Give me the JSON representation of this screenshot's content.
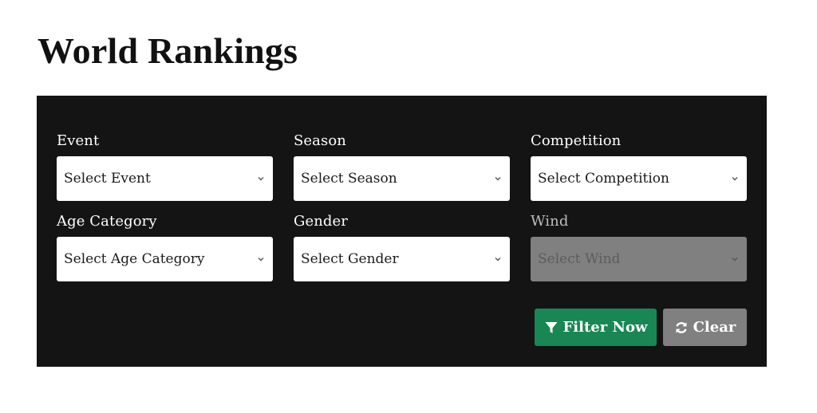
{
  "page": {
    "title": "World Rankings"
  },
  "filters": {
    "event": {
      "label": "Event",
      "value": "Select Event"
    },
    "season": {
      "label": "Season",
      "value": "Select Season"
    },
    "competition": {
      "label": "Competition",
      "value": "Select Competition"
    },
    "age_category": {
      "label": "Age Category",
      "value": "Select Age Category"
    },
    "gender": {
      "label": "Gender",
      "value": "Select Gender"
    },
    "wind": {
      "label": "Wind",
      "value": "Select Wind",
      "disabled": true
    }
  },
  "actions": {
    "filter_label": "Filter Now",
    "clear_label": "Clear"
  },
  "icons": {
    "filter": "filter-icon",
    "clear": "refresh-icon",
    "dropdown": "chevron-down-icon"
  },
  "colors": {
    "panel_background": "#141414",
    "filter_button": "#198754",
    "clear_button": "#808080",
    "disabled_select": "#808080"
  }
}
